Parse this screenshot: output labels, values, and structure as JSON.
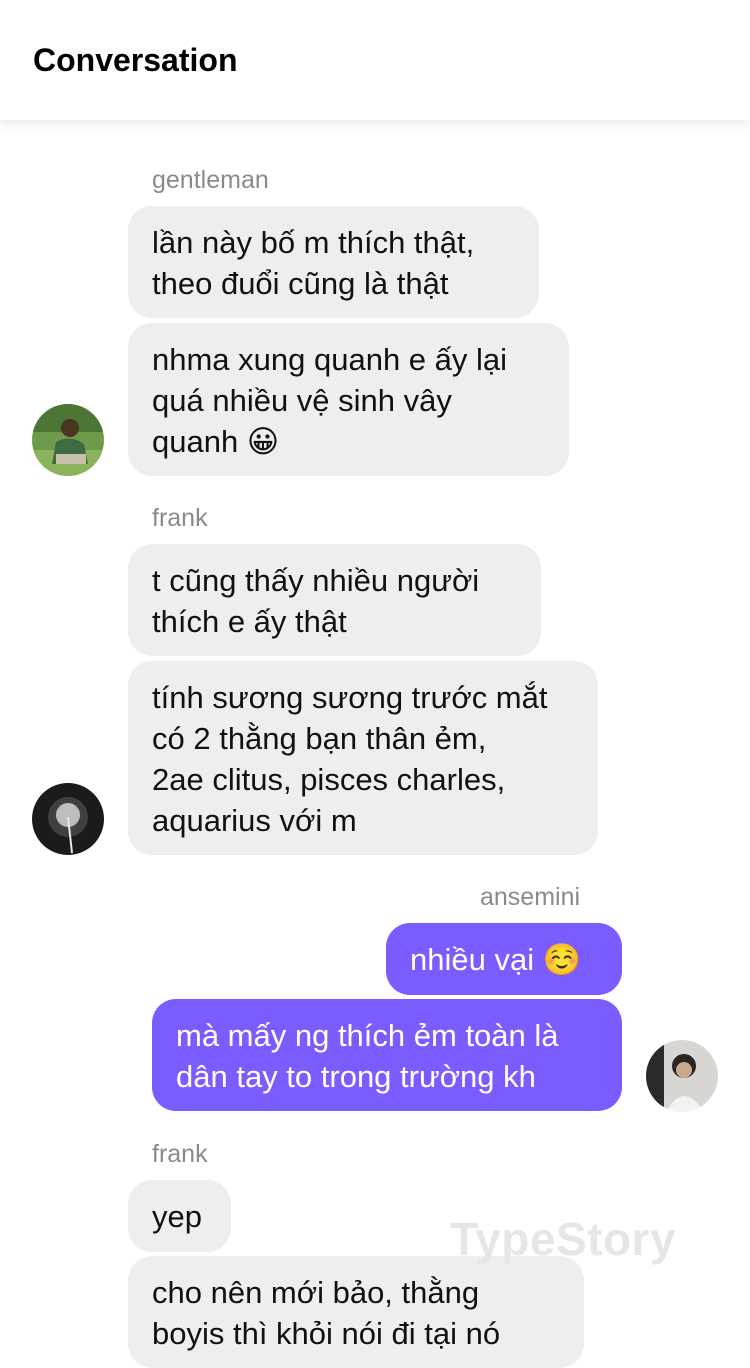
{
  "header": {
    "title": "Conversation"
  },
  "messages": [
    {
      "sender": "gentleman",
      "texts": [
        "lần này bố m thích thật,\ntheo đuổi cũng là thật",
        "nhma xung quanh e ấy lại\nquá nhiều vệ sinh vây\nquanh 😀"
      ]
    },
    {
      "sender": "frank",
      "texts": [
        "t cũng thấy nhiều người\nthích e ấy thật",
        "tính sương sương trước mắt\ncó 2 thằng bạn thân ẻm,\n2ae clitus, pisces charles,\naquarius với m"
      ]
    },
    {
      "sender": "ansemini",
      "texts": [
        "nhiều vại ☺️",
        "mà mấy ng thích ẻm toàn là\ndân tay to trong trường kh"
      ]
    },
    {
      "sender": "frank",
      "texts": [
        "yep",
        "cho nên mới bảo, thằng\nboyis thì khỏi nói đi tại nó"
      ]
    }
  ],
  "watermark": "TypeStory",
  "colors": {
    "outgoing_bubble": "#7b5cff",
    "incoming_bubble": "#eeeef0",
    "sender_name": "#8a8a8e"
  }
}
